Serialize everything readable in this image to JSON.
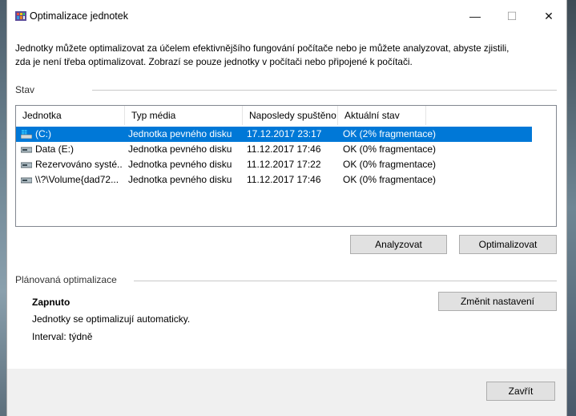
{
  "window": {
    "title": "Optimalizace jednotek",
    "controls": {
      "minimize": "—",
      "maximize": "☐",
      "close": "✕"
    }
  },
  "description": {
    "line1": "Jednotky můžete optimalizovat za účelem efektivnějšího fungování počítače nebo je můžete analyzovat, abyste zjistili,",
    "line2": "zda je není třeba optimalizovat. Zobrazí se pouze jednotky v počítači nebo připojené k počítači."
  },
  "status_group": {
    "label": "Stav"
  },
  "table": {
    "columns": [
      "Jednotka",
      "Typ média",
      "Naposledy spuštěno",
      "Aktuální stav"
    ],
    "rows": [
      {
        "drive": "(C:)",
        "media": "Jednotka pevného disku",
        "last_run": "17.12.2017 23:17",
        "status": "OK (2% fragmentace)",
        "icon": "windows-drive-icon",
        "selected": true
      },
      {
        "drive": "Data (E:)",
        "media": "Jednotka pevného disku",
        "last_run": "11.12.2017 17:46",
        "status": "OK (0% fragmentace)",
        "icon": "hard-drive-icon",
        "selected": false
      },
      {
        "drive": "Rezervováno systé...",
        "media": "Jednotka pevného disku",
        "last_run": "11.12.2017 17:22",
        "status": "OK (0% fragmentace)",
        "icon": "hard-drive-icon",
        "selected": false
      },
      {
        "drive": "\\\\?\\Volume{dad72...",
        "media": "Jednotka pevného disku",
        "last_run": "11.12.2017 17:46",
        "status": "OK (0% fragmentace)",
        "icon": "hard-drive-icon",
        "selected": false
      }
    ]
  },
  "buttons": {
    "analyze": "Analyzovat",
    "optimize": "Optimalizovat",
    "change_settings": "Změnit nastavení",
    "close": "Zavřít"
  },
  "scheduled": {
    "label": "Plánovaná optimalizace",
    "state": "Zapnuto",
    "description": "Jednotky se optimalizují automaticky.",
    "interval": "Interval: týdně"
  },
  "colors": {
    "selection": "#0078d7",
    "window_bg": "#f0f0f0"
  }
}
